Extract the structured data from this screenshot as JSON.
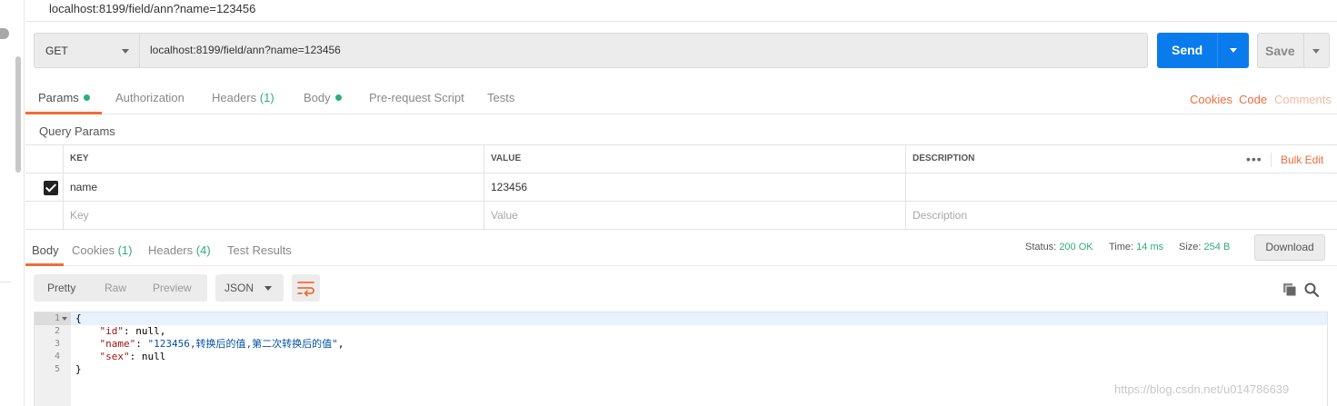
{
  "title_bar": {
    "text": "localhost:8199/field/ann?name=123456"
  },
  "request": {
    "method": "GET",
    "url": "localhost:8199/field/ann?name=123456",
    "send_label": "Send",
    "save_label": "Save"
  },
  "request_tabs": {
    "params": "Params",
    "authorization": "Authorization",
    "headers": "Headers",
    "headers_count": "(1)",
    "body": "Body",
    "pre_request": "Pre-request Script",
    "tests": "Tests",
    "cookies": "Cookies",
    "code": "Code",
    "comments": "Comments"
  },
  "query_params": {
    "title": "Query Params",
    "columns": {
      "key": "KEY",
      "value": "VALUE",
      "description": "DESCRIPTION"
    },
    "bulk_edit": "Bulk Edit",
    "more": "•••",
    "rows": [
      {
        "checked": true,
        "key": "name",
        "value": "123456",
        "description": ""
      }
    ],
    "placeholder": {
      "key": "Key",
      "value": "Value",
      "description": "Description"
    }
  },
  "response_tabs": {
    "body": "Body",
    "cookies": "Cookies",
    "cookies_count": "(1)",
    "headers": "Headers",
    "headers_count": "(4)",
    "test_results": "Test Results"
  },
  "response_status": {
    "status_label": "Status:",
    "status_value": "200 OK",
    "time_label": "Time:",
    "time_value": "14 ms",
    "size_label": "Size:",
    "size_value": "254 B",
    "download_label": "Download"
  },
  "view_options": {
    "pretty": "Pretty",
    "raw": "Raw",
    "preview": "Preview",
    "format": "JSON"
  },
  "code_lines": {
    "l1": {
      "num": "1",
      "text": "{"
    },
    "l2": {
      "num": "2",
      "indent": "    ",
      "key": "\"id\"",
      "sep": ": ",
      "value": "null",
      "end": ","
    },
    "l3": {
      "num": "3",
      "indent": "    ",
      "key": "\"name\"",
      "sep": ": ",
      "value": "\"123456,转换后的值,第二次转换后的值\"",
      "end": ","
    },
    "l4": {
      "num": "4",
      "indent": "    ",
      "key": "\"sex\"",
      "sep": ": ",
      "value": "null",
      "end": ""
    },
    "l5": {
      "num": "5",
      "text": "}"
    }
  },
  "watermark": "https://blog.csdn.net/u014786639",
  "colors": {
    "accent_orange": "#f26b3a",
    "send_blue": "#097bed",
    "status_green": "#2cae74"
  },
  "icons": [
    "chevron-down-icon",
    "checkbox-checked-icon",
    "wrap-lines-icon",
    "copy-icon",
    "search-icon",
    "more-dots-icon"
  ]
}
